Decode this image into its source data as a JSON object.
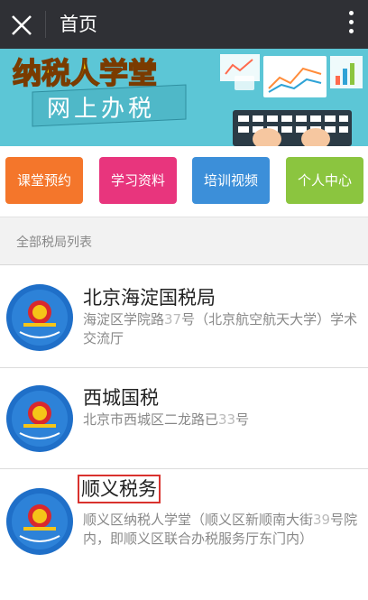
{
  "header": {
    "title": "首页"
  },
  "banner": {
    "headline": "纳税人学堂",
    "subtitle": "网上办税"
  },
  "nav_buttons": [
    {
      "label": "课堂预约",
      "color": "#f4762b"
    },
    {
      "label": "学习资料",
      "color": "#e8357d"
    },
    {
      "label": "培训视频",
      "color": "#3c8fd9"
    },
    {
      "label": "个人中心",
      "color": "#8bc53f"
    }
  ],
  "section": {
    "label": "全部税局列表"
  },
  "bureaus": [
    {
      "name": "北京海淀国税局",
      "addr1": "海淀区学院路",
      "addr_num": "37",
      "addr2": "号（北京航空航天大学）学术交流厅",
      "seal": "北京海淀国税局"
    },
    {
      "name": "西城国税",
      "addr1": "北京市西城区二龙路已",
      "addr_num": "33",
      "addr2": "号",
      "seal": "北京西城国税"
    },
    {
      "name": "顺义税务",
      "addr1": "顺义区纳税人学堂（顺义区新顺南大街",
      "addr_num": "39",
      "addr2": "号院 内，即顺义区联合办税服务厅东门内）",
      "seal": "顺义税务"
    }
  ]
}
